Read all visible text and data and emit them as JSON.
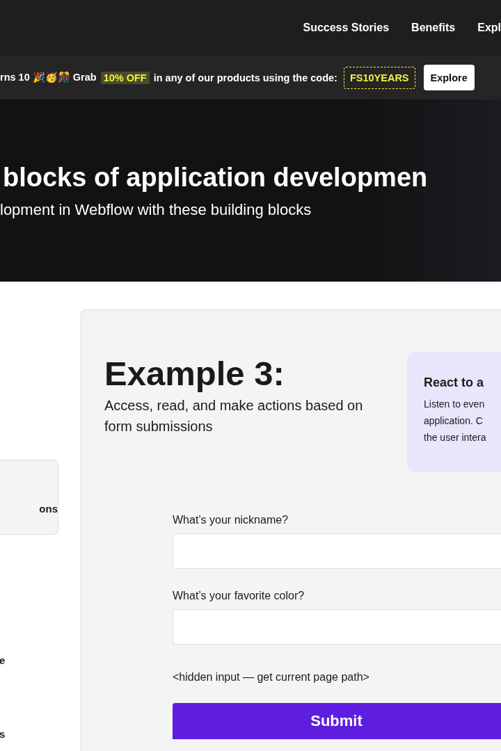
{
  "nav": {
    "links": [
      "Success Stories",
      "Benefits",
      "Expl"
    ]
  },
  "banner": {
    "text_start": "rns 10 🎉🥳🎊 Grab",
    "highlight": "10% OFF",
    "text_end": "in any of our products using the code:",
    "code": "FS10YEARS",
    "button": "Explore"
  },
  "hero": {
    "title": "blocks of application developmen",
    "subtitle": "lopment in Webflow with these building blocks"
  },
  "sidebar": {
    "card_text": "ons",
    "items": [
      "e",
      "s"
    ]
  },
  "example": {
    "title": "Example 3:",
    "description": "Access, read, and make actions based on form submissions",
    "side_card": {
      "title": "React to a",
      "lines": [
        "Listen to even",
        "application. C",
        "the user intera"
      ]
    },
    "form": {
      "fields": [
        {
          "label": "What’s your nickname?"
        },
        {
          "label": "What’s your favorite color?"
        }
      ],
      "hidden_note": "<hidden input — get current page path>",
      "submit": "Submit"
    }
  }
}
